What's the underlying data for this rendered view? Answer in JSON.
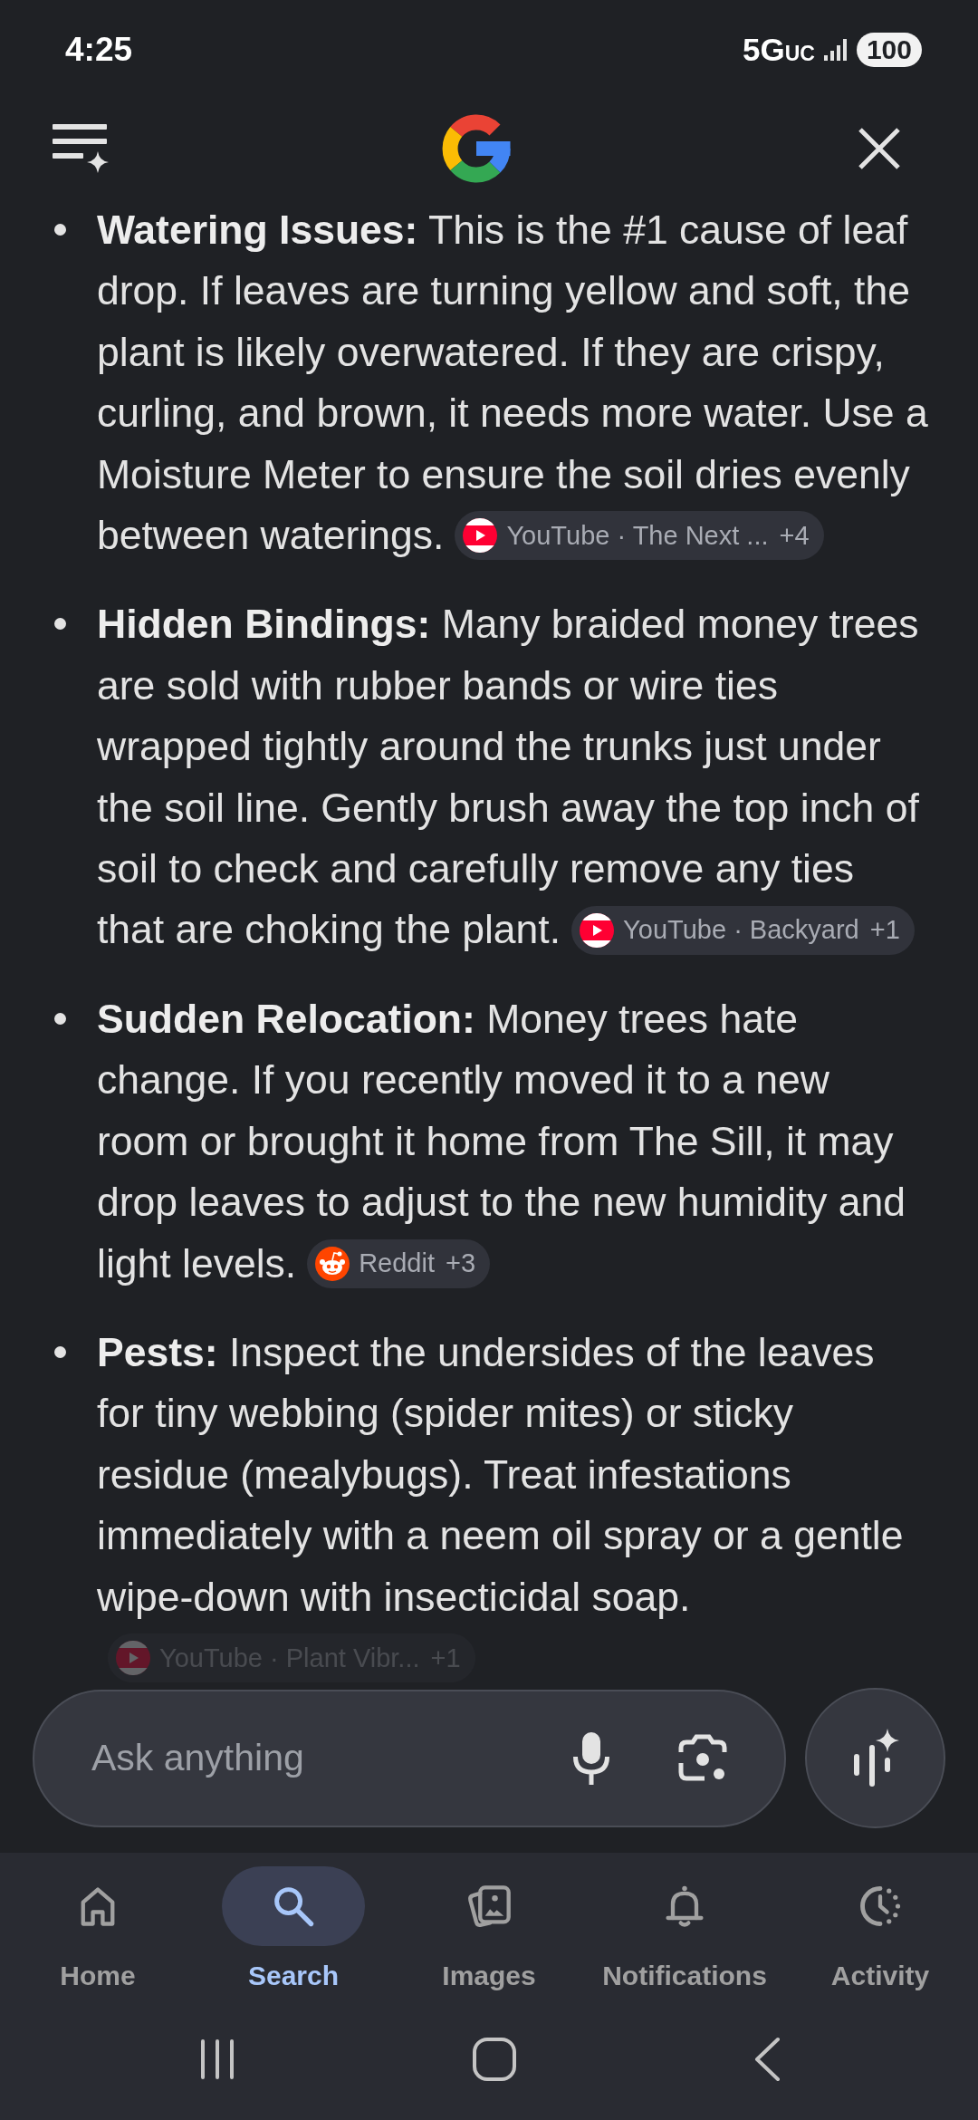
{
  "status_bar": {
    "time": "4:25",
    "network": "5G",
    "network_suffix": "UC",
    "battery": "100"
  },
  "answer": {
    "items": [
      {
        "text": "**Watering Issues:** This is the #1 cause of leaf drop. If leaves are turning yellow and soft, the plant is likely overwatered. If they are crispy, curling, and brown, it needs more water. Use a Moisture Meter to ensure the soil dries evenly between waterings.",
        "source": {
          "kind": "youtube",
          "label": "YouTube · The Next ...",
          "count": "+4",
          "faded": false
        }
      },
      {
        "text": "**Hidden Bindings:** Many braided money trees are sold with rubber bands or wire ties wrapped tightly around the trunks just under the soil line. Gently brush away the top inch of soil to check and carefully remove any ties that are choking the plant.",
        "source": {
          "kind": "youtube",
          "label": "YouTube · Backyard",
          "count": "+1",
          "faded": false
        }
      },
      {
        "text": "**Sudden Relocation:** Money trees hate change. If you recently moved it to a new room or brought it home from The Sill, it may drop leaves to adjust to the new humidity and light levels.",
        "source": {
          "kind": "reddit",
          "label": "Reddit",
          "count": "+3",
          "faded": false
        }
      },
      {
        "text": "**Pests:** Inspect the undersides of the leaves for tiny webbing (spider mites) or sticky residue (mealybugs). Treat infestations immediately with a neem oil spray or a gentle wipe-down with insecticidal soap.",
        "source": {
          "kind": "youtube",
          "label": "YouTube · Plant Vibr...",
          "count": "+1",
          "faded": true
        }
      }
    ]
  },
  "search_bar": {
    "placeholder": "Ask anything"
  },
  "bottom_nav": [
    {
      "label": "Home",
      "selected": false
    },
    {
      "label": "Search",
      "selected": true
    },
    {
      "label": "Images",
      "selected": false
    },
    {
      "label": "Notifications",
      "selected": false
    },
    {
      "label": "Activity",
      "selected": false
    }
  ]
}
